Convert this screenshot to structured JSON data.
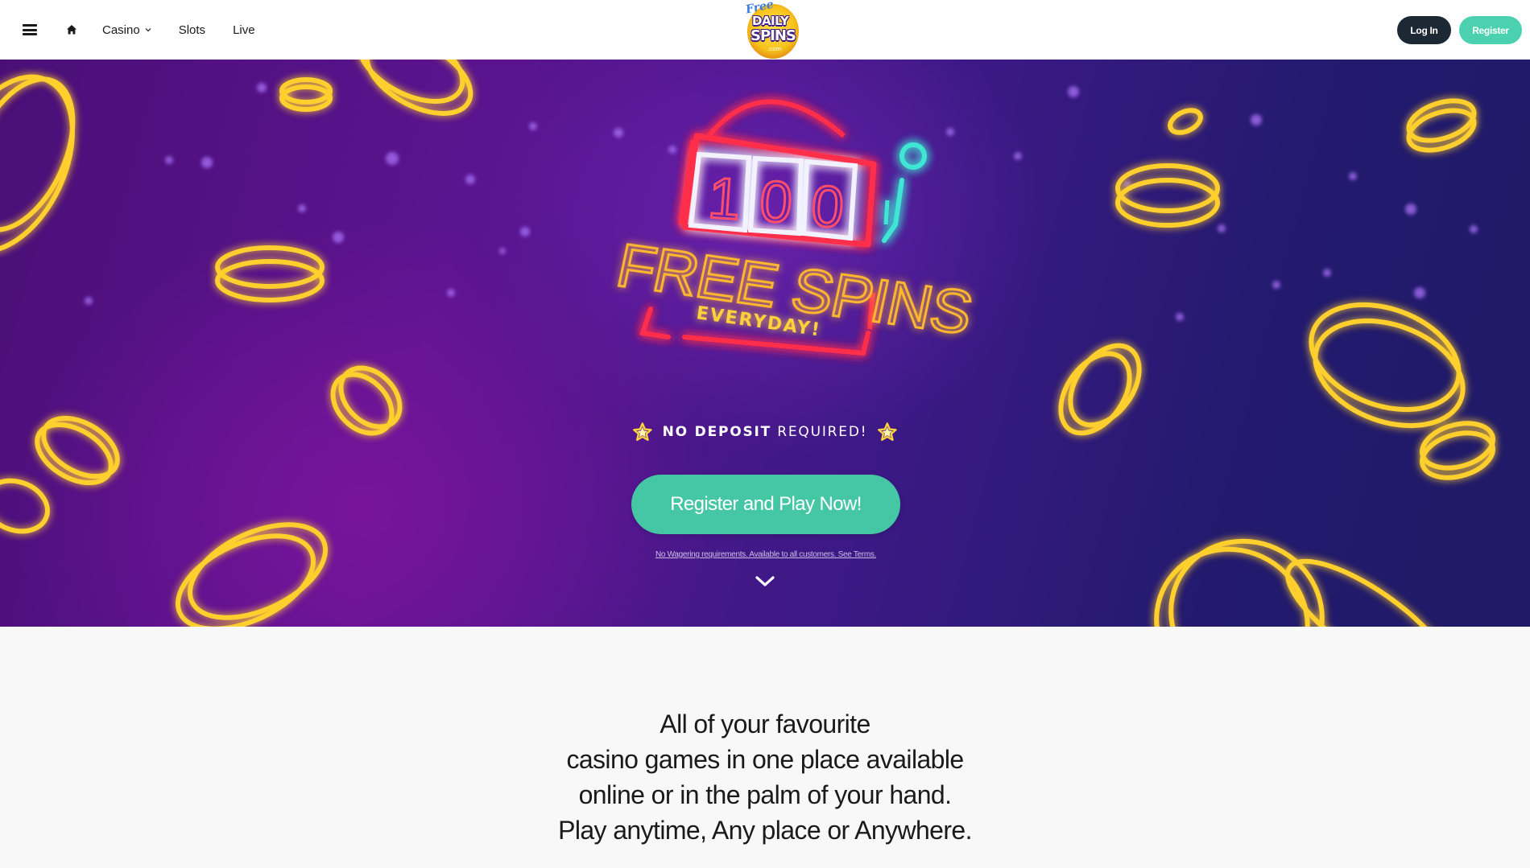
{
  "header": {
    "menu_icon": "hamburger-menu-icon",
    "home_icon": "home-icon",
    "nav": {
      "casino_label": "Casino",
      "slots_label": "Slots",
      "live_label": "Live"
    },
    "logo": {
      "line1": "Free",
      "line2": "DAILY",
      "line3": "SPINS",
      "line4": ".com"
    },
    "login_label": "Log In",
    "register_label": "Register"
  },
  "hero": {
    "sign": {
      "reels": [
        "1",
        "0",
        "0"
      ],
      "headline": "FREE SPINS",
      "subline": "EVERYDAY!"
    },
    "no_deposit_bold": "NO DEPOSIT",
    "no_deposit_rest": "REQUIRED!",
    "cta_label": "Register and Play Now!",
    "terms_text": "No Wagering requirements. Available to all customers. See Terms.",
    "scroll_icon": "chevron-down-icon"
  },
  "intro": {
    "lines": [
      "All of your favourite",
      "casino games in one place available",
      "online or in the palm of your hand.",
      "Play anytime, Any place or Anywhere."
    ]
  },
  "colors": {
    "accent": "#45c7a6",
    "login_button": "#1c2833",
    "hero_purple": "#4a0f77",
    "hero_indigo": "#1f1a66",
    "neon_red": "#ff3a55",
    "neon_yellow": "#ffd23a",
    "neon_teal": "#3fe6d4"
  }
}
